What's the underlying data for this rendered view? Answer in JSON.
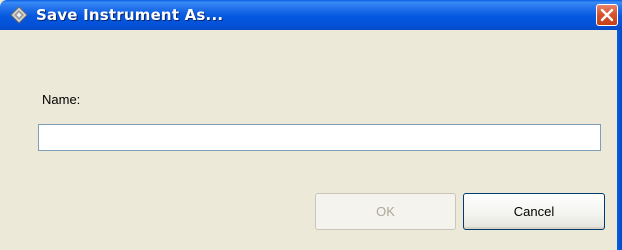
{
  "dialog": {
    "title": "Save Instrument As...",
    "app_icon": "instrument-app-icon",
    "close_icon": "close-icon"
  },
  "form": {
    "name_label": "Name:",
    "name_value": "",
    "name_placeholder": ""
  },
  "buttons": {
    "ok_label": "OK",
    "ok_enabled": false,
    "cancel_label": "Cancel"
  },
  "colors": {
    "titlebar": "#0558e0",
    "close_button": "#d8542e",
    "dialog_background": "#ece9d8",
    "disabled_text": "#aca899"
  }
}
